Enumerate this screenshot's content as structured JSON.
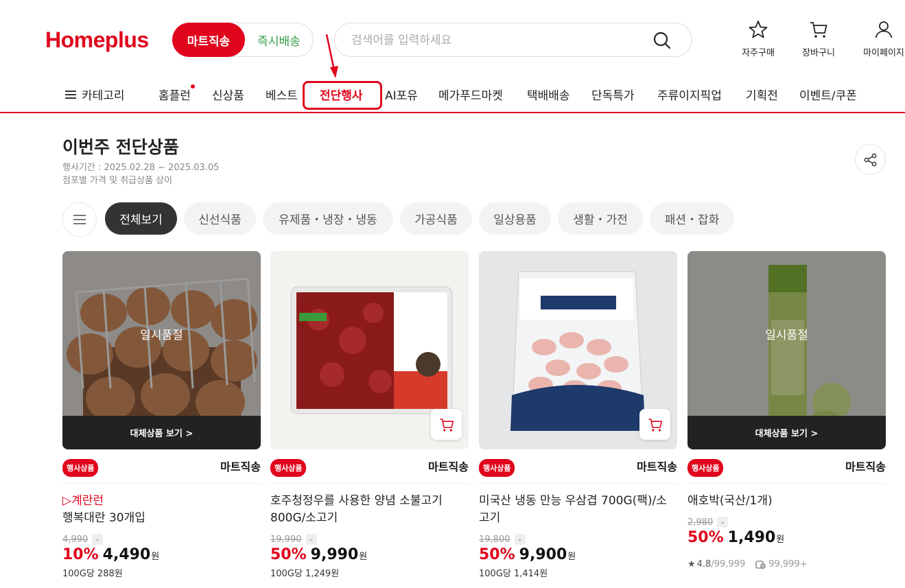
{
  "brand": {
    "logo_text": "Homeplus",
    "accent": "#e0051c"
  },
  "toggle": {
    "active": "마트직송",
    "inactive": "즉시배송"
  },
  "search": {
    "placeholder": "검색어를 입력하세요"
  },
  "utils": [
    {
      "label": "자주구매",
      "icon": "star-icon"
    },
    {
      "label": "장바구니",
      "icon": "cart-icon"
    },
    {
      "label": "마이페이지",
      "icon": "user-icon"
    }
  ],
  "gnb": {
    "category": "카테고리",
    "items": [
      "홈플런",
      "신상품",
      "베스트",
      "전단행사",
      "AI포유",
      "메가푸드마켓",
      "택배배송",
      "단독특가",
      "주류이지픽업",
      "기획전",
      "이벤트/쿠폰"
    ],
    "active": "전단행사"
  },
  "page": {
    "title": "이번주 전단상품",
    "period": "행사기간 : 2025.02.28 ~ 2025.03.05",
    "notice": "점포별 가격 및 취급상품 상이"
  },
  "filters": [
    "전체보기",
    "신선식품",
    "유제품・냉장・냉동",
    "가공식품",
    "일상용품",
    "생활・가전",
    "패션・잡화"
  ],
  "products": [
    {
      "image": "eggs-in-basket",
      "soldout": "일시품절",
      "alt_button": "대체상품 보기 >",
      "badge": "행사상품",
      "shipping": "마트직송",
      "tag": "▷계란런",
      "name": "행복대란 30개입",
      "original_price": "4,990",
      "discount": "10%",
      "price": "4,490",
      "won": "원",
      "unit_price": "100G당 288원"
    },
    {
      "image": "marinated-bulgogi",
      "badge": "행사상품",
      "shipping": "마트직송",
      "name": "호주청정우를 사용한 양념 소불고기 800G/소고기",
      "original_price": "19,990",
      "discount": "50%",
      "price": "9,990",
      "won": "원",
      "unit_price": "100G당 1,249원"
    },
    {
      "image": "frozen-pork-belly",
      "badge": "행사상품",
      "shipping": "마트직송",
      "name": "미국산 냉동 만능 우삼겹 700G(팩)/소고기",
      "original_price": "19,800",
      "discount": "50%",
      "price": "9,900",
      "won": "원",
      "unit_price": "100G당 1,414원"
    },
    {
      "image": "zucchini",
      "soldout": "일시품절",
      "alt_button": "대체상품 보기 >",
      "badge": "행사상품",
      "shipping": "마트직송",
      "name": "애호박(국산/1개)",
      "original_price": "2,980",
      "discount": "50%",
      "price": "1,490",
      "won": "원",
      "rating": "4.8",
      "rating_count": "/99,999",
      "wish_count": "99,999+"
    }
  ]
}
